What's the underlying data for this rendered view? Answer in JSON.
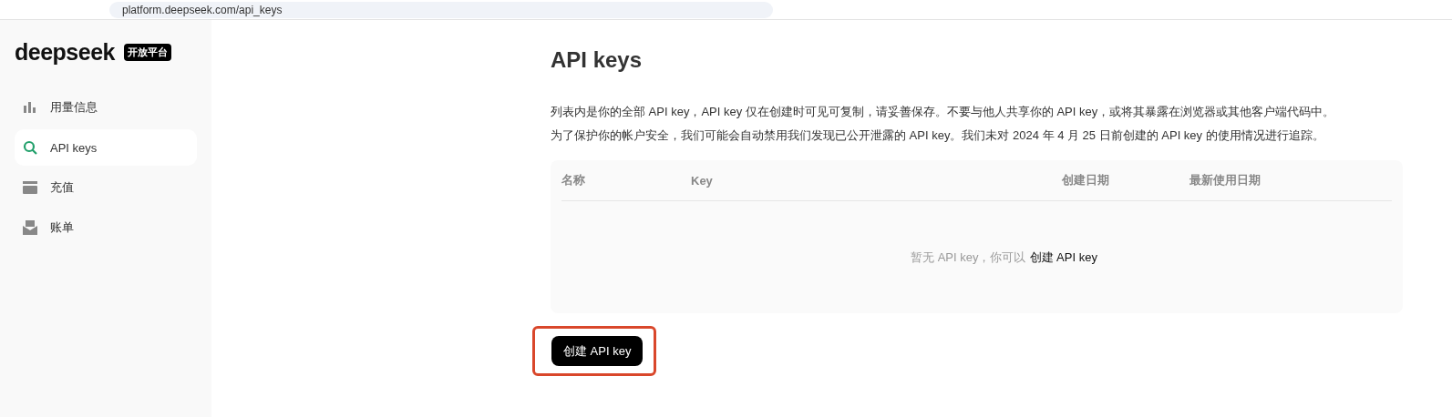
{
  "browser": {
    "url": "platform.deepseek.com/api_keys"
  },
  "sidebar": {
    "logo": "deepseek",
    "badge": "开放平台",
    "items": [
      {
        "label": "用量信息",
        "kind": "usage",
        "selected": false
      },
      {
        "label": "API keys",
        "kind": "keys",
        "selected": true
      },
      {
        "label": "充值",
        "kind": "topup",
        "selected": false
      },
      {
        "label": "账单",
        "kind": "bills",
        "selected": false
      }
    ]
  },
  "page": {
    "title": "API keys",
    "description": [
      "列表内是你的全部 API key，API key 仅在创建时可见可复制，请妥善保存。不要与他人共享你的 API key，或将其暴露在浏览器或其他客户端代码中。",
      "为了保护你的帐户安全，我们可能会自动禁用我们发现已公开泄露的 API key。我们未对 2024 年 4 月 25 日前创建的 API key 的使用情况进行追踪。"
    ],
    "table": {
      "columns": [
        "名称",
        "Key",
        "创建日期",
        "最新使用日期"
      ],
      "empty_text": "暂无 API key，你可以",
      "empty_link": "创建 API key"
    },
    "create_button": {
      "label": "创建 API key",
      "highlighted": true
    }
  }
}
